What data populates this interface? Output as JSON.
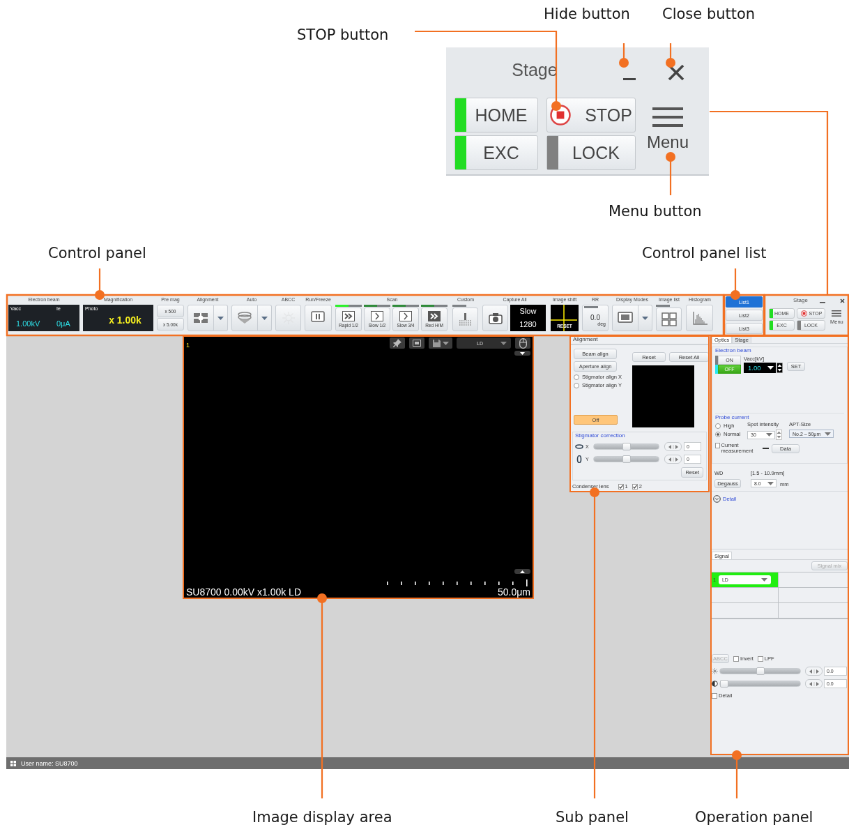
{
  "callouts": [
    {
      "label": "STOP button"
    },
    {
      "label": "Hide button"
    },
    {
      "label": "Close button"
    },
    {
      "label": "Menu button"
    },
    {
      "label": "Control panel"
    },
    {
      "label": "Control panel list"
    },
    {
      "label": "Image display area"
    },
    {
      "label": "Sub panel"
    },
    {
      "label": "Operation panel"
    }
  ],
  "stage_zoom": {
    "title": "Stage",
    "menu": "Menu",
    "buttons": [
      {
        "label": "HOME",
        "kind": "indicator",
        "color": "#22dd22"
      },
      {
        "label": "STOP",
        "kind": "stop"
      },
      {
        "label": "EXC",
        "kind": "indicator",
        "color": "#22dd22"
      },
      {
        "label": "LOCK",
        "kind": "indicator",
        "color": "#808080"
      }
    ]
  },
  "control_panel": [
    {
      "kind": "readout",
      "title": "Electron beam",
      "labels": [
        "Vacc",
        "Ie"
      ],
      "values": [
        "1.00kV",
        "0μA"
      ]
    },
    {
      "kind": "magnification",
      "title": "Magnification",
      "label": "Photo",
      "value": "x 1.00k"
    },
    {
      "kind": "premag",
      "title": "Pre mag",
      "buttons": [
        "x 500",
        "x 5.00k"
      ]
    },
    {
      "kind": "alignment",
      "title": "Alignment"
    },
    {
      "kind": "auto",
      "title": "Auto"
    },
    {
      "kind": "abcc",
      "title": "ABCC",
      "disabled": true
    },
    {
      "kind": "run_freeze",
      "title": "Run/Freeze"
    },
    {
      "kind": "scan",
      "title": "Scan",
      "modes": [
        {
          "label": "Rapid 1/2",
          "selected": true
        },
        {
          "label": "Slow 1/2",
          "selected": false
        },
        {
          "label": "Slow 3/4",
          "selected": false
        },
        {
          "label": "Red H/M",
          "selected": false
        }
      ]
    },
    {
      "kind": "custom",
      "title": "Custom"
    },
    {
      "kind": "capture",
      "title": "Capture All",
      "mode": "Slow",
      "count": "1280"
    },
    {
      "kind": "image_shift",
      "title": "Image shift",
      "button": "RESET"
    },
    {
      "kind": "rr",
      "title": "RR",
      "value": "0.0",
      "unit": "deg"
    },
    {
      "kind": "display_modes",
      "title": "Display Modes"
    },
    {
      "kind": "image_list",
      "title": "Image list"
    },
    {
      "kind": "histogram",
      "title": "Histogram"
    }
  ],
  "panel_lists": [
    {
      "label": "List1",
      "selected": true
    },
    {
      "label": "List2",
      "selected": false
    },
    {
      "label": "List3",
      "selected": false
    }
  ],
  "stage_panel": {
    "title": "Stage",
    "menu": "Menu",
    "buttons": [
      {
        "label": "HOME",
        "kind": "indicator",
        "color": "#22dd22"
      },
      {
        "label": "STOP",
        "kind": "stop"
      },
      {
        "label": "EXC",
        "kind": "indicator",
        "color": "#22dd22"
      },
      {
        "label": "LOCK",
        "kind": "indicator",
        "color": "#808080"
      }
    ]
  },
  "image_view": {
    "number": "1",
    "detector": "LD",
    "caption": "SU8700 0.00kV x1.00k LD",
    "scale": "50.0μm"
  },
  "sub_panel": {
    "title": "Alignment",
    "align_buttons": [
      "Beam align",
      "Aperture align"
    ],
    "reset_buttons": [
      "Reset",
      "Reset All"
    ],
    "radios": [
      {
        "label": "Stigmator align X",
        "selected": false
      },
      {
        "label": "Stigmator align Y",
        "selected": false
      }
    ],
    "toggle": {
      "label": "Off",
      "on": true
    },
    "stigmator": {
      "title": "Stigmator correction",
      "rows": [
        {
          "axis": "X",
          "level": 0.5,
          "value": "0"
        },
        {
          "axis": "Y",
          "level": 0.5,
          "value": "0"
        }
      ],
      "reset": "Reset"
    },
    "condenser": {
      "label": "Condenser lens",
      "options": [
        {
          "label": "1",
          "checked": true
        },
        {
          "label": "2",
          "checked": true
        }
      ]
    }
  },
  "operation_panel": {
    "tabs": [
      {
        "label": "Optics",
        "selected": true
      },
      {
        "label": "Stage",
        "selected": false
      }
    ],
    "electron_beam": {
      "title": "Electron beam",
      "power": [
        {
          "label": "ON",
          "selected": false
        },
        {
          "label": "OFF",
          "selected": true
        }
      ],
      "vacc_label": "Vacc[kV]",
      "vacc": "1.00",
      "set": "SET"
    },
    "probe_current": {
      "title": "Probe current",
      "modes": [
        {
          "label": "High",
          "selected": false
        },
        {
          "label": "Normal",
          "selected": true
        }
      ],
      "spot_label": "Spot intensity",
      "spot": "30",
      "apt_label": "APT-Size",
      "apt": "No.2 – 50μm",
      "current_label": "Current measurement",
      "current_checked": false,
      "data": "Data"
    },
    "wd": {
      "label": "WD",
      "range": "[1.5 - 10.9mm]",
      "degauss": "Degauss",
      "value": "8.0",
      "unit": "mm"
    },
    "detail": "Detail",
    "signal": {
      "tab": "Signal",
      "mix": "Signal mix",
      "slots": [
        {
          "number": "1",
          "detector": "LD",
          "selected": true
        }
      ],
      "abcc": "ABCC",
      "options": [
        {
          "label": "Invert",
          "checked": false
        },
        {
          "label": "LPF",
          "checked": false
        }
      ],
      "sliders": [
        {
          "kind": "brightness",
          "level": 0.5,
          "value": "0.0"
        },
        {
          "kind": "contrast",
          "level": 0,
          "value": "0.0"
        }
      ],
      "detail": {
        "label": "Detail",
        "checked": false
      }
    }
  },
  "status_bar": {
    "user": "User name: SU8700"
  }
}
